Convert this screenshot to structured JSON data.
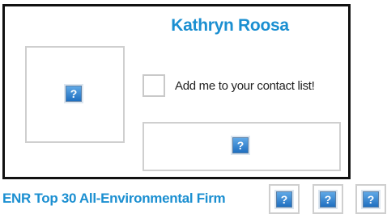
{
  "profile": {
    "name": "Kathryn Roosa",
    "photo_icon": "broken-image-icon",
    "photo_icon_glyph": "?"
  },
  "contact": {
    "checkbox_checked": false,
    "label": "Add me to your contact list!"
  },
  "banner": {
    "icon": "broken-image-icon",
    "icon_glyph": "?"
  },
  "footer": {
    "text": "ENR Top 30 All-Environmental Firm",
    "badges": [
      {
        "icon": "broken-image-icon",
        "glyph": "?"
      },
      {
        "icon": "broken-image-icon",
        "glyph": "?"
      },
      {
        "icon": "broken-image-icon",
        "glyph": "?"
      }
    ]
  },
  "colors": {
    "accent": "#1b8fd1",
    "card_border": "#111111",
    "box_border": "#cfcfcf",
    "icon_fill": "#1f6fc0"
  }
}
